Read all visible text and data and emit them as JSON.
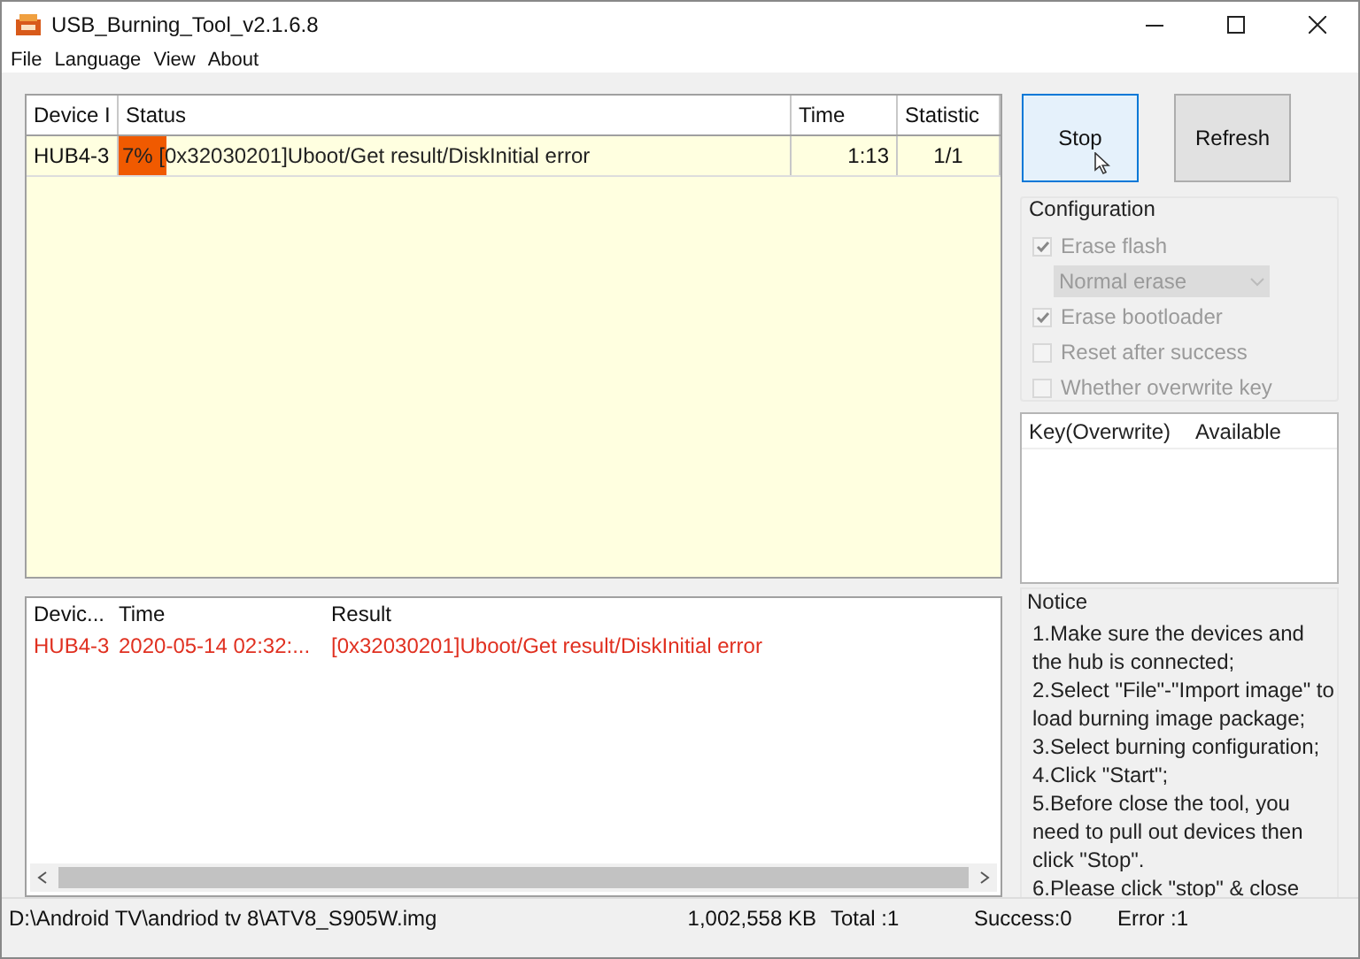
{
  "window": {
    "title": "USB_Burning_Tool_v2.1.6.8"
  },
  "menu": [
    "File",
    "Language",
    "View",
    "About"
  ],
  "device_table": {
    "columns": [
      "Device I",
      "Status",
      "Time",
      "Statistic"
    ],
    "rows": [
      {
        "device": "HUB4-3",
        "progress": "7%",
        "level": 0.07,
        "status": "[0x32030201]Uboot/Get result/DiskInitial error",
        "time": "1:13",
        "statistic": "1/1"
      }
    ]
  },
  "log": {
    "columns": [
      "Devic...",
      "Time",
      "Result"
    ],
    "rows": [
      {
        "device": "HUB4-3",
        "time": "2020-05-14 02:32:...",
        "result": "[0x32030201]Uboot/Get result/DiskInitial error",
        "error": true
      }
    ]
  },
  "buttons": [
    {
      "label": "Stop",
      "hovered": true
    },
    {
      "label": "Refresh",
      "hovered": false
    }
  ],
  "configuration": {
    "title": "Configuration",
    "items": [
      {
        "kind": "checkbox",
        "label": "Erase flash",
        "checked": true,
        "disabled": true
      },
      {
        "kind": "dropdown",
        "value": "Normal erase",
        "disabled": true
      },
      {
        "kind": "checkbox",
        "label": "Erase bootloader",
        "checked": true,
        "disabled": true
      },
      {
        "kind": "checkbox",
        "label": "Reset after success",
        "checked": false,
        "disabled": true
      },
      {
        "kind": "checkbox",
        "label": "Whether overwrite key",
        "checked": false,
        "disabled": true
      }
    ]
  },
  "key_table": {
    "columns": [
      "Key(Overwrite)",
      "Available"
    ]
  },
  "notice": {
    "title": "Notice",
    "items": [
      "1.Make sure the devices and the hub is connected;",
      "2.Select \"File\"-\"Import image\" to load burning image package;",
      "3.Select burning configuration;",
      "4.Click \"Start\";",
      "5.Before close the tool, you need to pull out devices then click \"Stop\".",
      "6.Please click \"stop\" & close"
    ]
  },
  "status_bar": {
    "path": "D:\\Android TV\\andriod tv 8\\ATV8_S905W.img",
    "size": "1,002,558 KB",
    "total": "Total :1",
    "success": "Success:0",
    "error": "Error :1"
  }
}
